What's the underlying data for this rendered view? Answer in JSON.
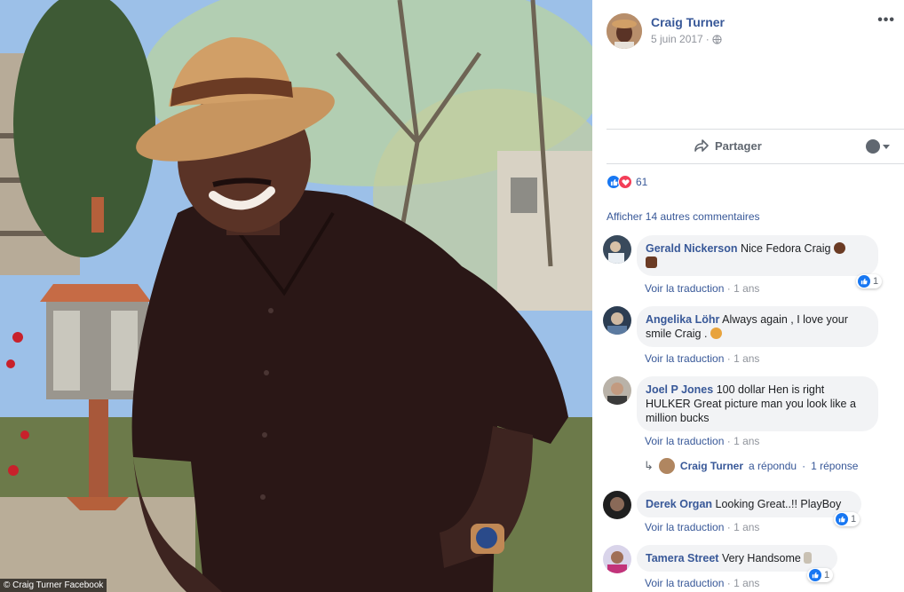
{
  "photo": {
    "alt": "Man in a straw fedora and dark shirt smiling in front of trees",
    "watermark": "© Craig Turner Facebook"
  },
  "post": {
    "author": "Craig Turner",
    "date": "5 juin 2017",
    "date_separator": "·",
    "privacy_icon": "globe-icon",
    "more_icon": "ellipsis-icon",
    "more_label": "•••"
  },
  "actions": {
    "share_label": "Partager",
    "share_icon": "share-arrow-icon"
  },
  "reactions": {
    "icons": [
      "like-icon",
      "love-icon"
    ],
    "count": "61"
  },
  "more_comments_label": "Afficher 14 autres commentaires",
  "comments": [
    {
      "author": "Gerald Nickerson",
      "text": "Nice Fedora Craig",
      "emoji": [
        "clapping-hands-emoji",
        "thumbs-up-emoji"
      ],
      "translate": "Voir la traduction",
      "separator": "·",
      "time": "1 ans",
      "likes": "1"
    },
    {
      "author": "Angelika Löhr",
      "text": "Always again , I love your smile Craig .",
      "emoji": [
        "lion-emoji"
      ],
      "translate": "Voir la traduction",
      "separator": "·",
      "time": "1 ans"
    },
    {
      "author": "Joel P Jones",
      "text": "100 dollar Hen is right HULKER Great picture man you look like a million bucks",
      "translate": "Voir la traduction",
      "separator": "·",
      "time": "1 ans",
      "reply": {
        "author": "Craig Turner",
        "action": "a répondu",
        "separator": "·",
        "count": "1 réponse"
      }
    },
    {
      "author": "Derek Organ",
      "text": "Looking Great..!! PlayBoy",
      "translate": "Voir la traduction",
      "separator": "·",
      "time": "1 ans",
      "likes": "1"
    },
    {
      "author": "Tamera Street",
      "text": "Very Handsome",
      "emoji": [
        "man-standing-emoji"
      ],
      "translate": "Voir la traduction",
      "separator": "·",
      "time": "1 ans",
      "likes": "1"
    }
  ],
  "colors": {
    "link_blue": "#385898",
    "like_blue": "#1877f2",
    "love_red": "#f33e58",
    "bubble_gray": "#f2f3f5",
    "meta_gray": "#90949c"
  }
}
